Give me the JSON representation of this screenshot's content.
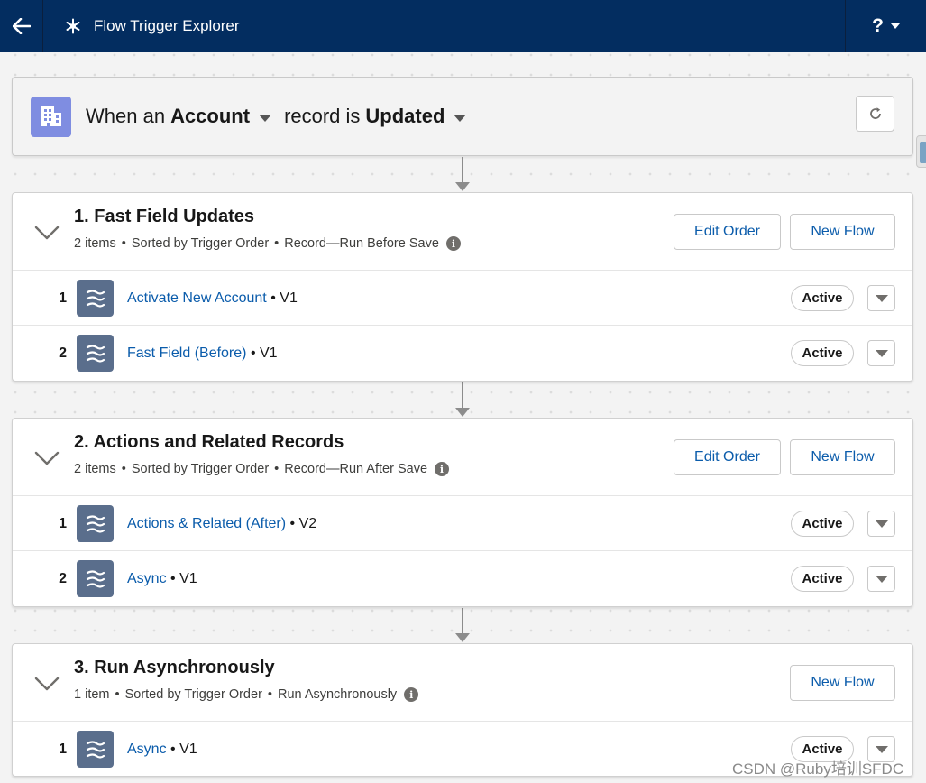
{
  "header": {
    "app_title": "Flow Trigger Explorer",
    "help_label": "?"
  },
  "trigger": {
    "prefix": "When an",
    "object": "Account",
    "middle": "record is",
    "event": "Updated"
  },
  "groups": [
    {
      "title": "1. Fast Field Updates",
      "item_count": "2 items",
      "sort": "Sorted by Trigger Order",
      "run_mode": "Record—Run Before Save",
      "edit_order_label": "Edit Order",
      "new_flow_label": "New Flow",
      "flows": [
        {
          "num": "1",
          "name": "Activate New Account",
          "version": "V1",
          "status": "Active"
        },
        {
          "num": "2",
          "name": "Fast Field (Before)",
          "version": "V1",
          "status": "Active"
        }
      ]
    },
    {
      "title": "2. Actions and Related Records",
      "item_count": "2 items",
      "sort": "Sorted by Trigger Order",
      "run_mode": "Record—Run After Save",
      "edit_order_label": "Edit Order",
      "new_flow_label": "New Flow",
      "flows": [
        {
          "num": "1",
          "name": "Actions & Related (After)",
          "version": "V2",
          "status": "Active"
        },
        {
          "num": "2",
          "name": "Async",
          "version": "V1",
          "status": "Active"
        }
      ]
    },
    {
      "title": "3. Run Asynchronously",
      "item_count": "1 item",
      "sort": "Sorted by Trigger Order",
      "run_mode": "Run Asynchronously",
      "new_flow_label": "New Flow",
      "flows": [
        {
          "num": "1",
          "name": "Async",
          "version": "V1",
          "status": "Active"
        }
      ]
    }
  ],
  "separator": "•",
  "watermark": "CSDN @Ruby培训SFDC",
  "colors": {
    "header_bg": "#032d60",
    "link": "#0b5cab",
    "object_icon_bg": "#7f8de1",
    "flow_icon_bg": "#5a6e8c"
  }
}
